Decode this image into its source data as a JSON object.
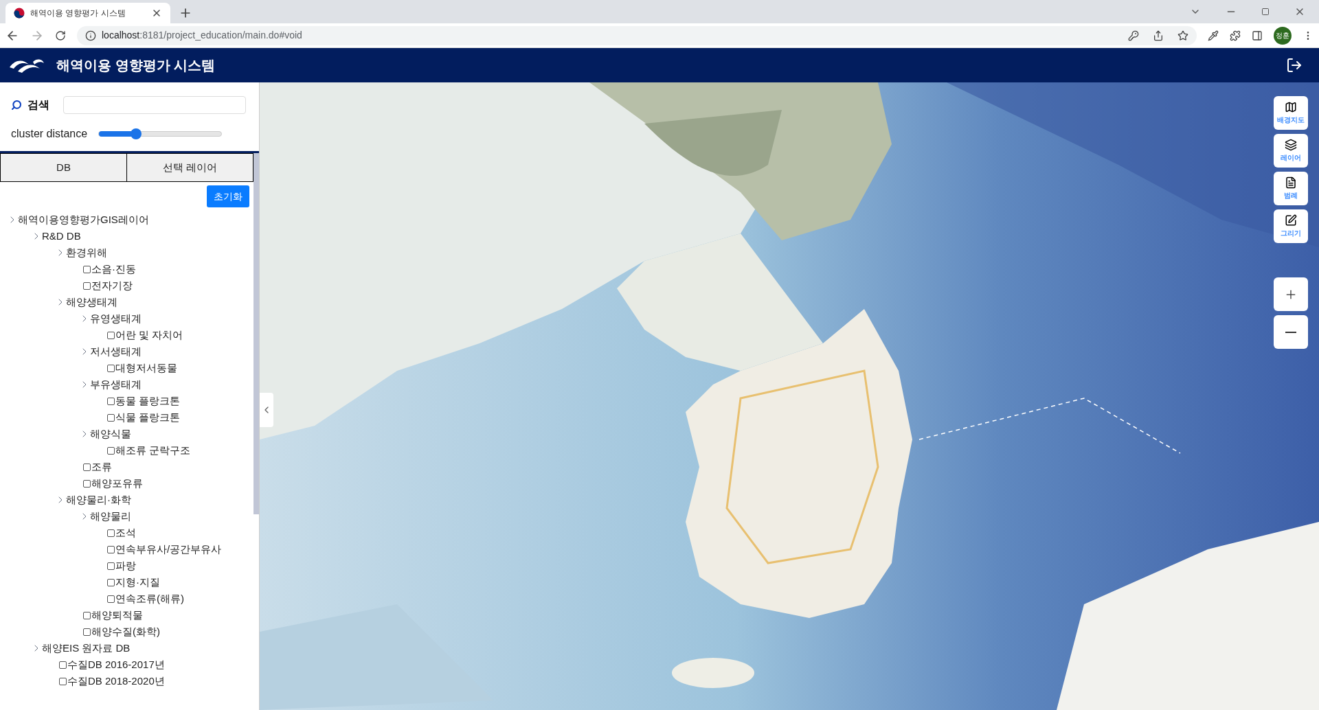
{
  "browser": {
    "tab_title": "해역이용 영향평가 시스템",
    "url_host": "localhost",
    "url_rest": ":8181/project_education/main.do#void",
    "profile": "정훈"
  },
  "header": {
    "title": "해역이용 영향평가 시스템"
  },
  "search": {
    "label": "검색"
  },
  "cluster": {
    "label": "cluster distance",
    "level": 0.3
  },
  "tabs": [
    {
      "label": "DB"
    },
    {
      "label": "선택 레이어"
    }
  ],
  "reset_button": "초기화",
  "tree": [
    {
      "kind": "group",
      "label": "해역이용영향평가GIS레이어",
      "children": [
        {
          "kind": "group",
          "label": "R&D DB",
          "children": [
            {
              "kind": "group",
              "label": "환경위해",
              "children": [
                {
                  "kind": "layer",
                  "label": "소음·진동",
                  "checked": false
                },
                {
                  "kind": "layer",
                  "label": "전자기장",
                  "checked": false
                }
              ]
            },
            {
              "kind": "group",
              "label": "해양생태계",
              "children": [
                {
                  "kind": "group",
                  "label": "유영생태계",
                  "children": [
                    {
                      "kind": "layer",
                      "label": "어란 및 자치어",
                      "checked": false
                    }
                  ]
                },
                {
                  "kind": "group",
                  "label": "저서생태계",
                  "children": [
                    {
                      "kind": "layer",
                      "label": "대형저서동물",
                      "checked": false
                    }
                  ]
                },
                {
                  "kind": "group",
                  "label": "부유생태계",
                  "children": [
                    {
                      "kind": "layer",
                      "label": "동물 플랑크톤",
                      "checked": false
                    },
                    {
                      "kind": "layer",
                      "label": "식물 플랑크톤",
                      "checked": false
                    }
                  ]
                },
                {
                  "kind": "group",
                  "label": "해양식물",
                  "children": [
                    {
                      "kind": "layer",
                      "label": "해조류 군락구조",
                      "checked": false
                    }
                  ]
                },
                {
                  "kind": "layer",
                  "label": "조류",
                  "checked": false
                },
                {
                  "kind": "layer",
                  "label": "해양포유류",
                  "checked": false
                }
              ]
            },
            {
              "kind": "group",
              "label": "해양물리·화학",
              "children": [
                {
                  "kind": "group",
                  "label": "해양물리",
                  "children": [
                    {
                      "kind": "layer",
                      "label": "조석",
                      "checked": false
                    },
                    {
                      "kind": "layer",
                      "label": "연속부유사/공간부유사",
                      "checked": false
                    },
                    {
                      "kind": "layer",
                      "label": "파랑",
                      "checked": false
                    },
                    {
                      "kind": "layer",
                      "label": "지형·지질",
                      "checked": false
                    },
                    {
                      "kind": "layer",
                      "label": "연속조류(해류)",
                      "checked": false
                    }
                  ]
                },
                {
                  "kind": "layer",
                  "label": "해양퇴적물",
                  "checked": false
                },
                {
                  "kind": "layer",
                  "label": "해양수질(화학)",
                  "checked": false
                }
              ]
            }
          ]
        },
        {
          "kind": "group",
          "label": "해양EIS 원자료 DB",
          "children": [
            {
              "kind": "layer",
              "label": "수질DB 2016-2017년",
              "checked": false
            },
            {
              "kind": "layer",
              "label": "수질DB 2018-2020년",
              "checked": false
            }
          ]
        }
      ]
    }
  ],
  "map_tools": [
    {
      "kind": "map",
      "label": "배경지도"
    },
    {
      "kind": "layers",
      "label": "레이어"
    },
    {
      "kind": "legend",
      "label": "범례"
    },
    {
      "kind": "draw",
      "label": "그리기"
    }
  ],
  "zoom_controls": [
    {
      "kind": "plus"
    },
    {
      "kind": "minus"
    }
  ]
}
